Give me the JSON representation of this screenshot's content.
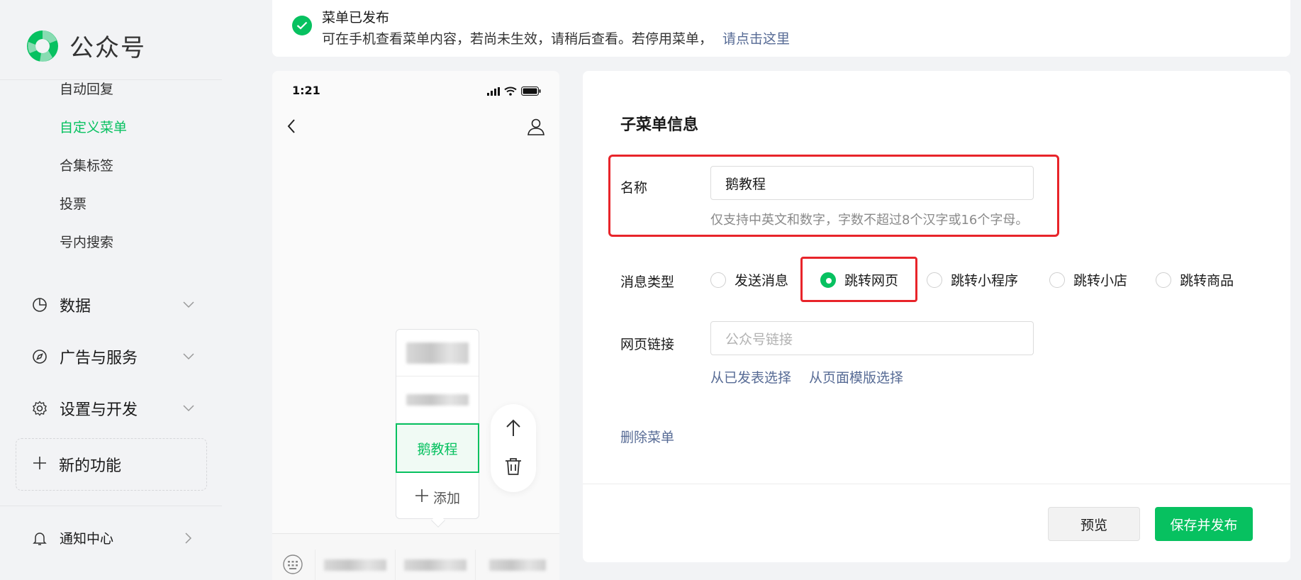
{
  "brand": {
    "name": "公众号",
    "accent": "#07c160",
    "link_color": "#576b95",
    "highlight": "#e8242a"
  },
  "sidebar": {
    "sub_items": [
      {
        "label": "自动回复",
        "active": false
      },
      {
        "label": "自定义菜单",
        "active": true
      },
      {
        "label": "合集标签",
        "active": false
      },
      {
        "label": "投票",
        "active": false
      },
      {
        "label": "号内搜索",
        "active": false
      }
    ],
    "groups": [
      {
        "label": "数据",
        "icon": "pie-chart-icon"
      },
      {
        "label": "广告与服务",
        "icon": "compass-icon"
      },
      {
        "label": "设置与开发",
        "icon": "gear-icon"
      }
    ],
    "new_feature": {
      "label": "新的功能",
      "icon": "plus-icon"
    },
    "notification": {
      "label": "通知中心",
      "icon": "bell-icon"
    }
  },
  "notice": {
    "title": "菜单已发布",
    "desc": "可在手机查看菜单内容，若尚未生效，请稍后查看。若停用菜单，",
    "link": "请点击这里"
  },
  "phone": {
    "time": "1:21",
    "submenu_selected": "鹅教程",
    "add_label": "添加"
  },
  "panel": {
    "title": "子菜单信息",
    "name_label": "名称",
    "name_value": "鹅教程",
    "name_hint": "仅支持中英文和数字，字数不超过8个汉字或16个字母。",
    "msg_type_label": "消息类型",
    "msg_types": [
      {
        "label": "发送消息",
        "checked": false
      },
      {
        "label": "跳转网页",
        "checked": true
      },
      {
        "label": "跳转小程序",
        "checked": false
      },
      {
        "label": "跳转小店",
        "checked": false
      },
      {
        "label": "跳转商品",
        "checked": false
      }
    ],
    "url_label": "网页链接",
    "url_placeholder": "公众号链接",
    "from_published": "从已发表选择",
    "from_template": "从页面模版选择",
    "delete_menu": "删除菜单",
    "preview_btn": "预览",
    "save_btn": "保存并发布"
  }
}
